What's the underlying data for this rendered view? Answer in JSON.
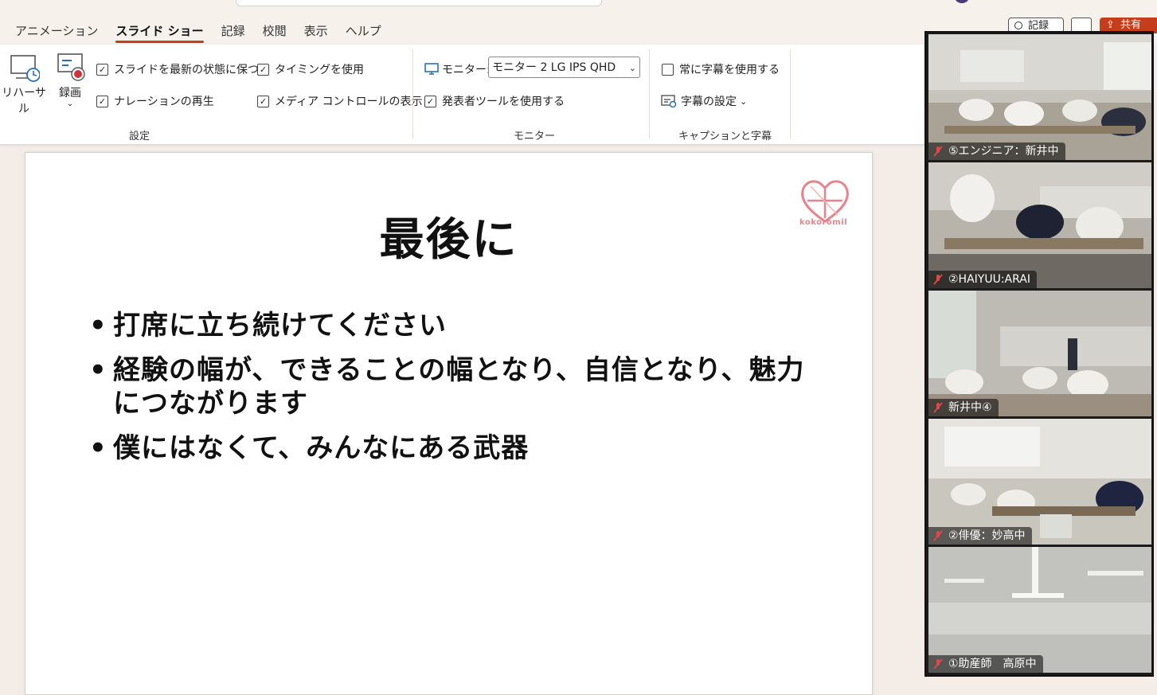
{
  "tabs": [
    "アニメーション",
    "スライド ショー",
    "記録",
    "校閲",
    "表示",
    "ヘルプ"
  ],
  "active_tab": "スライド ショー",
  "header_right": {
    "record_label": "記録",
    "share_label": "共有"
  },
  "ribbon": {
    "rehearse_label": "リハーサル",
    "record_label": "録画",
    "setup_checks": [
      {
        "label": "スライドを最新の状態に保つ",
        "checked": true
      },
      {
        "label": "ナレーションの再生",
        "checked": true
      },
      {
        "label": "タイミングを使用",
        "checked": true
      },
      {
        "label": "メディア コントロールの表示",
        "checked": true
      }
    ],
    "setup_group": "設定",
    "monitor_label": "モニター:",
    "monitor_value": "モニター 2 LG IPS QHD",
    "presenter_tools_label": "発表者ツールを使用する",
    "presenter_tools_checked": true,
    "monitor_group": "モニター",
    "always_subtitles_label": "常に字幕を使用する",
    "always_subtitles_checked": false,
    "subtitle_settings_label": "字幕の設定",
    "captions_group": "キャプションと字幕"
  },
  "slide": {
    "title": "最後に",
    "bullets": [
      "打席に立ち続けてください",
      "経験の幅が、できることの幅となり、自信となり、魅力につながります",
      "僕にはなくて、みんなにある武器"
    ],
    "logo_text": "kokoromil"
  },
  "video_tiles": [
    {
      "name": "⑤エンジニア：新井中",
      "muted": true
    },
    {
      "name": "②HAIYUU:ARAI",
      "muted": true
    },
    {
      "name": "新井中④",
      "muted": true
    },
    {
      "name": "②俳優：妙高中",
      "muted": true
    },
    {
      "name": "①助産師　高原中",
      "muted": true
    }
  ],
  "colors": {
    "accent": "#c43e1c",
    "logo": "#e8838c"
  }
}
